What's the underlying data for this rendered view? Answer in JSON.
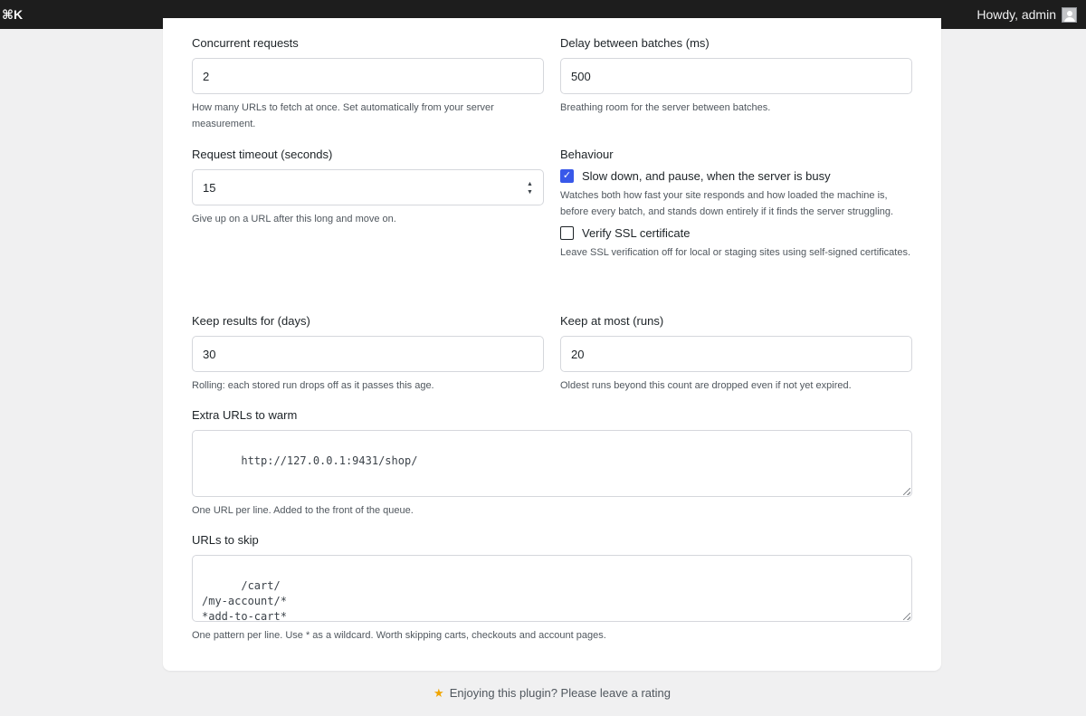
{
  "adminbar": {
    "logo": "⌘K",
    "howdy": "Howdy, admin"
  },
  "settings": {
    "concurrent": {
      "label": "Concurrent requests",
      "value": "2",
      "help": "How many URLs to fetch at once. Set automatically from your server measurement."
    },
    "delay": {
      "label": "Delay between batches (ms)",
      "value": "500",
      "help": "Breathing room for the server between batches."
    },
    "timeout": {
      "label": "Request timeout (seconds)",
      "value": "15",
      "help": "Give up on a URL after this long and move on."
    },
    "behaviour": {
      "label": "Behaviour",
      "slowdown": {
        "label": "Slow down, and pause, when the server is busy",
        "checked": true,
        "help": "Watches both how fast your site responds and how loaded the machine is, before every batch, and stands down entirely if it finds the server struggling."
      },
      "ssl": {
        "label": "Verify SSL certificate",
        "checked": false,
        "help": "Leave SSL verification off for local or staging sites using self-signed certificates."
      }
    },
    "keep_days": {
      "label": "Keep results for (days)",
      "value": "30",
      "help": "Rolling: each stored run drops off as it passes this age."
    },
    "keep_runs": {
      "label": "Keep at most (runs)",
      "value": "20",
      "help": "Oldest runs beyond this count are dropped even if not yet expired."
    },
    "extra_urls": {
      "label": "Extra URLs to warm",
      "value": "http://127.0.0.1:9431/shop/",
      "help": "One URL per line. Added to the front of the queue."
    },
    "skip_urls": {
      "label": "URLs to skip",
      "value": "/cart/\n/my-account/*\n*add-to-cart*",
      "help": "One pattern per line. Use * as a wildcard. Worth skipping carts, checkouts and account pages."
    }
  },
  "footer": {
    "rating_text": "Enjoying this plugin? Please leave a rating"
  },
  "colors": {
    "accent": "#3858e9",
    "star": "#f0a500",
    "adminbar": "#1d1d1d"
  }
}
